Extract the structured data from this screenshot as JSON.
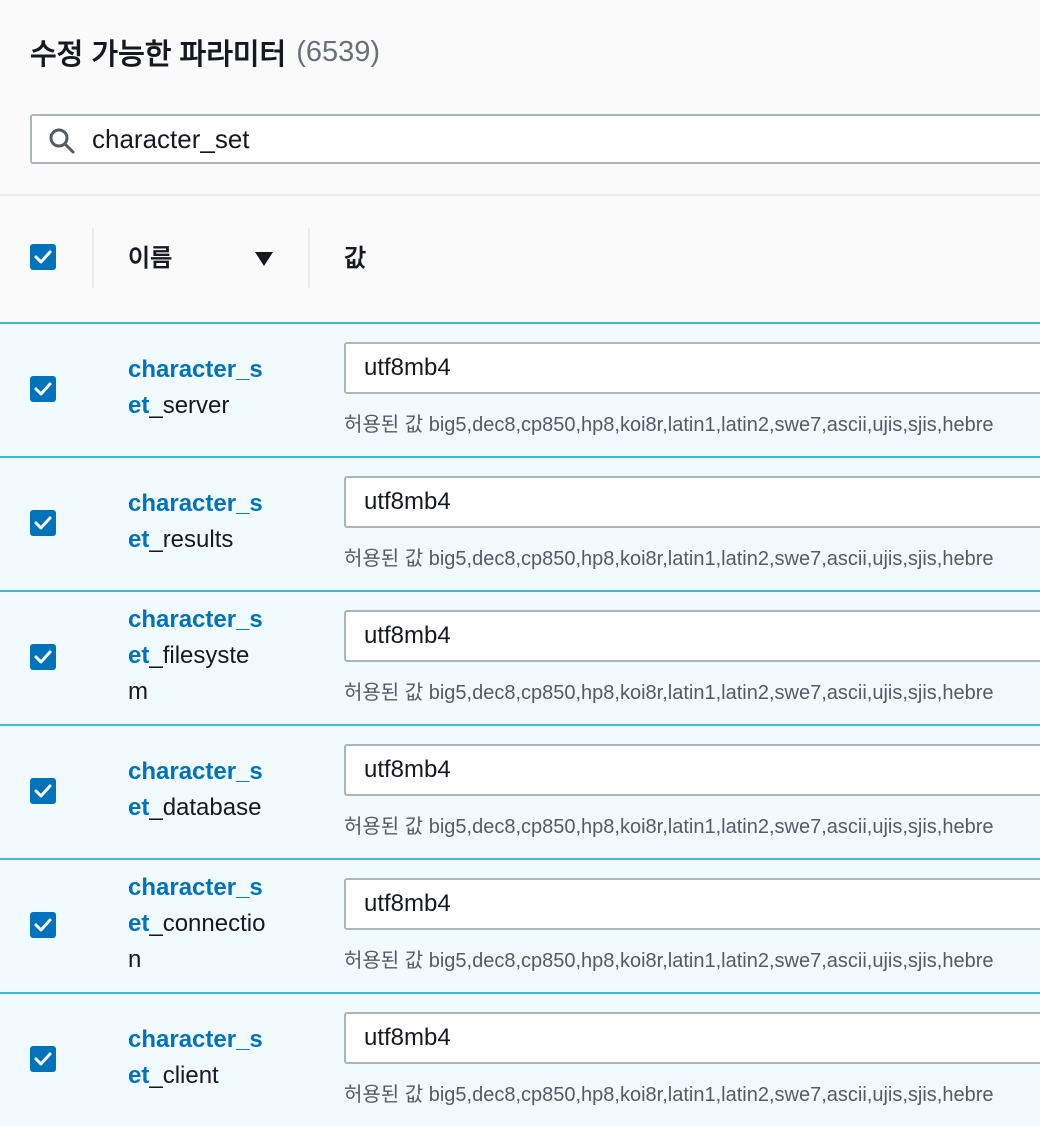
{
  "header": {
    "title": "수정 가능한 파라미터",
    "count": "(6539)"
  },
  "search": {
    "icon": "search-icon",
    "value": "character_set"
  },
  "table": {
    "columns": {
      "name": "이름",
      "value": "값"
    },
    "sort_icon": "caret-down-icon",
    "select_all_checked": true,
    "rows": [
      {
        "name_match": "character_set",
        "name_rest": "_server",
        "value": "utf8mb4",
        "allowed": "허용된 값 big5,dec8,cp850,hp8,koi8r,latin1,latin2,swe7,ascii,ujis,sjis,hebre",
        "checked": true
      },
      {
        "name_match": "character_set",
        "name_rest": "_results",
        "value": "utf8mb4",
        "allowed": "허용된 값 big5,dec8,cp850,hp8,koi8r,latin1,latin2,swe7,ascii,ujis,sjis,hebre",
        "checked": true
      },
      {
        "name_match": "character_set",
        "name_rest": "_filesystem",
        "value": "utf8mb4",
        "allowed": "허용된 값 big5,dec8,cp850,hp8,koi8r,latin1,latin2,swe7,ascii,ujis,sjis,hebre",
        "checked": true
      },
      {
        "name_match": "character_set",
        "name_rest": "_database",
        "value": "utf8mb4",
        "allowed": "허용된 값 big5,dec8,cp850,hp8,koi8r,latin1,latin2,swe7,ascii,ujis,sjis,hebre",
        "checked": true
      },
      {
        "name_match": "character_set",
        "name_rest": "_connection",
        "value": "utf8mb4",
        "allowed": "허용된 값 big5,dec8,cp850,hp8,koi8r,latin1,latin2,swe7,ascii,ujis,sjis,hebre",
        "checked": true
      },
      {
        "name_match": "character_set",
        "name_rest": "_client",
        "value": "utf8mb4",
        "allowed": "허용된 값 big5,dec8,cp850,hp8,koi8r,latin1,latin2,swe7,ascii,ujis,sjis,hebre",
        "checked": true
      }
    ]
  },
  "colors": {
    "accent": "#0073bb",
    "row_border": "#44b9d6",
    "row_background": "#f1faff"
  }
}
